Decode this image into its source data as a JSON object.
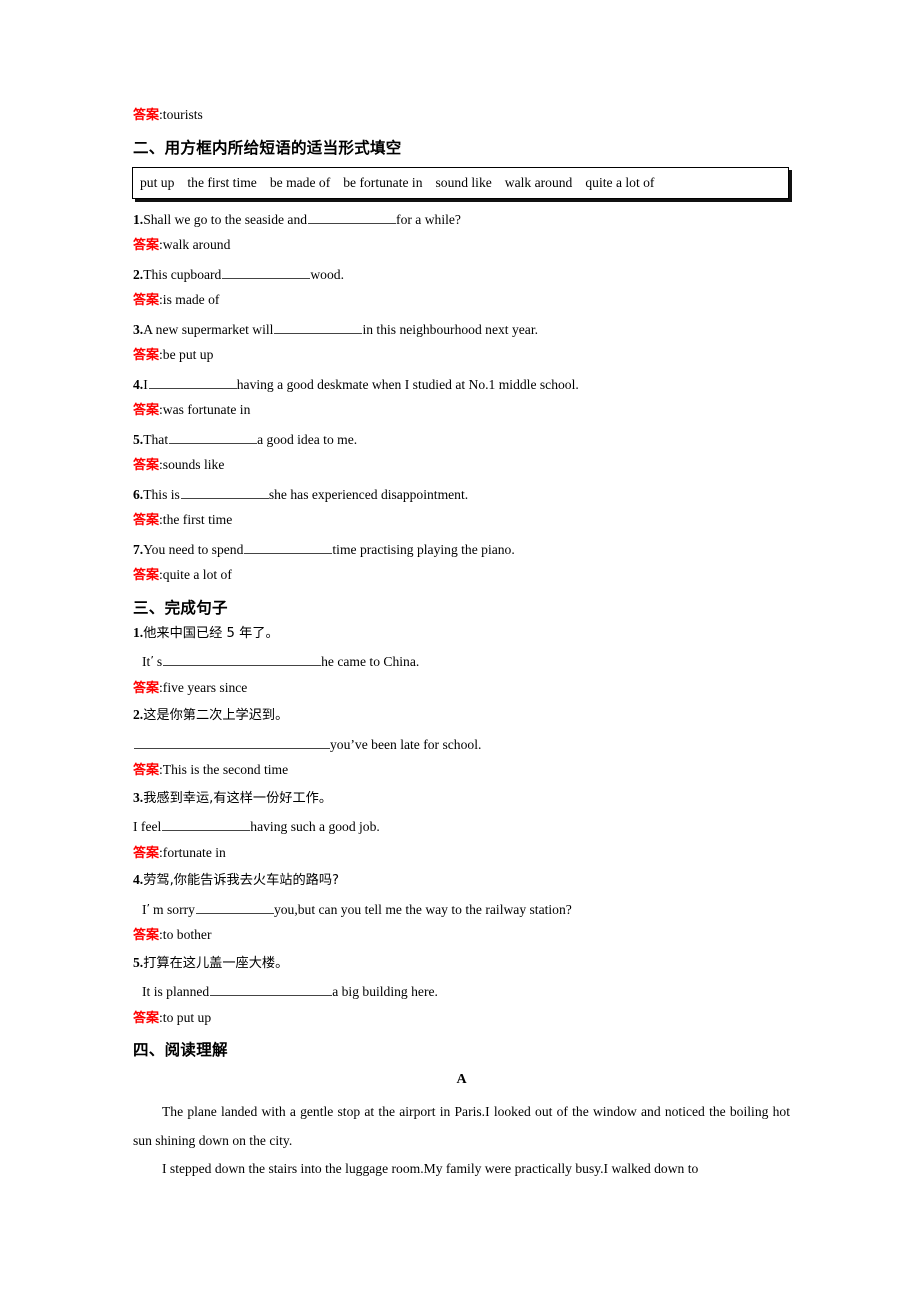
{
  "answer_label": "答案",
  "colon": ":",
  "top_answer": {
    "label": "答案",
    "value": "tourists"
  },
  "section2": {
    "heading": "二、用方框内所给短语的适当形式填空",
    "phrase_box": [
      "put up",
      "the first time",
      "be made of",
      "be fortunate in",
      "sound like",
      "walk around",
      "quite a lot of"
    ],
    "items": [
      {
        "num": "1.",
        "pre": "Shall we go to the seaside and",
        "post": "for a while?",
        "answer": "walk around"
      },
      {
        "num": "2.",
        "pre": "This cupboard",
        "post": "wood.",
        "answer": "is made of"
      },
      {
        "num": "3.",
        "pre": "A new supermarket will",
        "post": "in this neighbourhood next year.",
        "answer": "be put up"
      },
      {
        "num": "4.",
        "pre": "I",
        "post": "having a good deskmate when I studied at No.1 middle school.",
        "answer": "was fortunate in"
      },
      {
        "num": "5.",
        "pre": "That",
        "post": "a good idea to me.",
        "answer": "sounds like"
      },
      {
        "num": "6.",
        "pre": "This is",
        "post": "she has experienced disappointment.",
        "answer": "the first time"
      },
      {
        "num": "7.",
        "pre": "You need to spend",
        "post": "time practising playing the piano.",
        "answer": "quite a lot of"
      }
    ]
  },
  "section3": {
    "heading": "三、完成句子",
    "items": [
      {
        "num": "1.",
        "chinese": "他来中国已经 5 年了。",
        "en_pre": "It",
        "en_apos": "’",
        "en_mid": "s",
        "en_post": "he came to China.",
        "answer": "five years since"
      },
      {
        "num": "2.",
        "chinese": "这是你第二次上学迟到。",
        "en_pre": "",
        "en_apos": "’",
        "en_mid": "",
        "en_post": "you’ve been late for school.",
        "answer": "This is the second time"
      },
      {
        "num": "3.",
        "chinese": "我感到幸运,有这样一份好工作。",
        "en_pre": "I feel",
        "en_apos": "",
        "en_mid": "",
        "en_post": "having such a good job.",
        "answer": "fortunate in"
      },
      {
        "num": "4.",
        "chinese": "劳驾,你能告诉我去火车站的路吗?",
        "en_pre": "I",
        "en_apos": "’",
        "en_mid": "m sorry",
        "en_post": "you,but can you tell me the way to the railway station?",
        "answer": "to bother"
      },
      {
        "num": "5.",
        "chinese": "打算在这儿盖一座大楼。",
        "en_pre": "It is planned",
        "en_apos": "",
        "en_mid": "",
        "en_post": "a big building here.",
        "answer": "to put up"
      }
    ]
  },
  "section4": {
    "heading": "四、阅读理解",
    "passage_label": "A",
    "paragraphs": [
      "The plane landed with a gentle stop at the airport in Paris.I looked out of the window and noticed the boiling hot sun shining down on the city.",
      "I stepped down the stairs into the luggage room.My family were practically busy.I walked down to"
    ]
  },
  "colors": {
    "answer_red": "#ff0000",
    "text_black": "#000000",
    "page_bg": "#ffffff",
    "blank_line": "#444444"
  }
}
